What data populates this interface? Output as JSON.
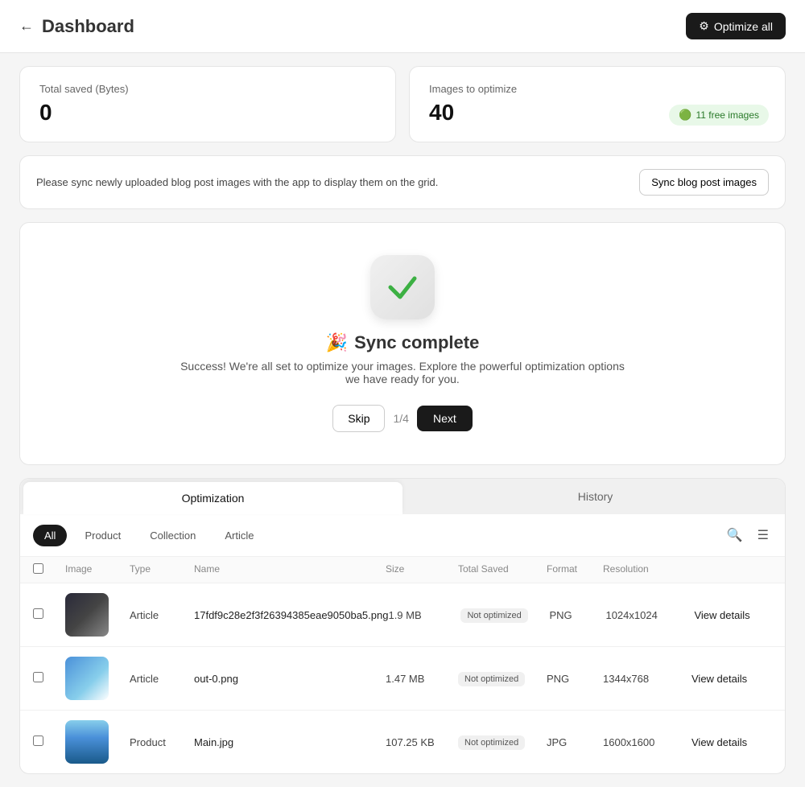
{
  "header": {
    "title": "Dashboard",
    "optimize_all_label": "Optimize all",
    "back_icon": "←"
  },
  "stats": {
    "left": {
      "label": "Total saved (Bytes)",
      "value": "0"
    },
    "right": {
      "label": "Images to optimize",
      "value": "40",
      "badge_label": "11 free images"
    }
  },
  "sync_banner": {
    "text": "Please sync newly uploaded blog post images with the app to display them on the grid.",
    "button_label": "Sync blog post images"
  },
  "sync_complete": {
    "emoji": "🎉",
    "title": "Sync complete",
    "description": "Success! We're all set to optimize your images. Explore the powerful optimization options we have ready for you.",
    "skip_label": "Skip",
    "page_indicator": "1/4",
    "next_label": "Next"
  },
  "tabs": {
    "optimization_label": "Optimization",
    "history_label": "History"
  },
  "filters": {
    "all_label": "All",
    "product_label": "Product",
    "collection_label": "Collection",
    "article_label": "Article"
  },
  "table": {
    "columns": {
      "image": "Image",
      "type": "Type",
      "name": "Name",
      "size": "Size",
      "total_saved": "Total Saved",
      "format": "Format",
      "resolution": "Resolution"
    },
    "rows": [
      {
        "id": 1,
        "type": "Article",
        "name": "17fdf9c28e2f3f26394385eae9050ba5.png",
        "size": "1.9 MB",
        "total_saved": "Not optimized",
        "format": "PNG",
        "resolution": "1024x1024",
        "view_details": "View details"
      },
      {
        "id": 2,
        "type": "Article",
        "name": "out-0.png",
        "size": "1.47 MB",
        "total_saved": "Not optimized",
        "format": "PNG",
        "resolution": "1344x768",
        "view_details": "View details"
      },
      {
        "id": 3,
        "type": "Product",
        "name": "Main.jpg",
        "size": "107.25 KB",
        "total_saved": "Not optimized",
        "format": "JPG",
        "resolution": "1600x1600",
        "view_details": "View details"
      }
    ]
  }
}
